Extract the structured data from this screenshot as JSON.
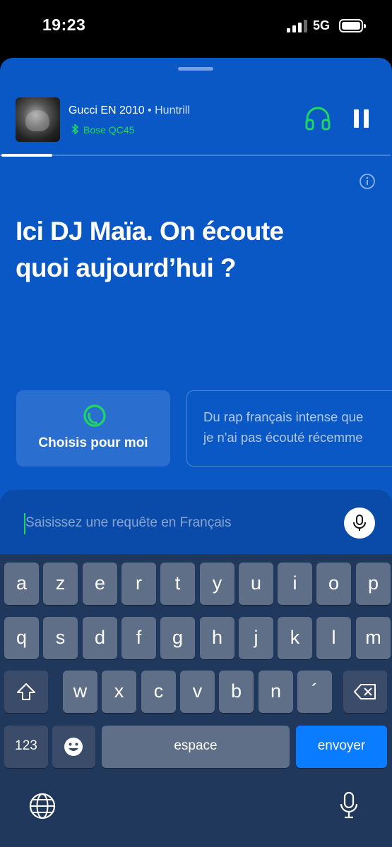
{
  "status_bar": {
    "time": "19:23",
    "network": "5G"
  },
  "now_playing": {
    "title": "Gucci EN 2010",
    "separator": " • ",
    "artist": "Huntrill",
    "device": "Bose QC45",
    "progress": 0.13
  },
  "dj": {
    "headline_line1": "Ici DJ Maïa. On écoute",
    "headline_line2": "quoi aujourd’hui ?",
    "choose_label": "Choisis pour moi",
    "suggestion_line1": "Du rap français intense que",
    "suggestion_line2": "je n'ai pas écouté récemme"
  },
  "input": {
    "placeholder": "Saisissez une requête en Français"
  },
  "keyboard": {
    "row1": [
      "a",
      "z",
      "e",
      "r",
      "t",
      "y",
      "u",
      "i",
      "o",
      "p"
    ],
    "row2": [
      "q",
      "s",
      "d",
      "f",
      "g",
      "h",
      "j",
      "k",
      "l",
      "m"
    ],
    "row3": [
      "w",
      "x",
      "c",
      "v",
      "b",
      "n",
      "´"
    ],
    "numbers_label": "123",
    "space_label": "espace",
    "send_label": "envoyer"
  },
  "colors": {
    "accent": "#1ed760",
    "sheet": "#0a57c6",
    "send": "#0a7cff"
  },
  "icons": [
    "bluetooth-icon",
    "headphones-icon",
    "pause-icon",
    "info-icon",
    "dj-circle-icon",
    "microphone-icon",
    "shift-icon",
    "backspace-icon",
    "emoji-icon",
    "globe-icon"
  ]
}
